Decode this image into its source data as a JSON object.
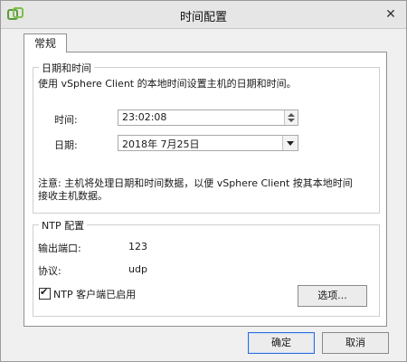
{
  "window": {
    "title": "时间配置"
  },
  "tabs": [
    {
      "label": "常规"
    }
  ],
  "datetime": {
    "legend": "日期和时间",
    "description": "使用 vSphere Client 的本地时间设置主机的日期和时间。",
    "time_label": "时间:",
    "time_value": "23:02:08",
    "date_label": "日期:",
    "date_value": "2018年  7月25日",
    "note_line1": "注意: 主机将处理日期和时间数据，以便 vSphere Client 按其本地时间",
    "note_line2": "接收主机数据。"
  },
  "ntp": {
    "legend": "NTP 配置",
    "outgoing_port_label": "输出端口:",
    "outgoing_port_value": "123",
    "protocol_label": "协议:",
    "protocol_value": "udp",
    "client_enabled_label": "NTP 客户端已启用",
    "client_enabled": true,
    "options_button": "选项..."
  },
  "footer": {
    "ok_button": "确定",
    "cancel_button": "取消"
  },
  "icons": {
    "app": "vsphere-app-icon",
    "close": "close-icon",
    "check": "checkmark-icon"
  },
  "colors": {
    "titlebar": "#e6e6e6",
    "panel": "#ffffff",
    "default_button_border": "#2f6bd6"
  }
}
